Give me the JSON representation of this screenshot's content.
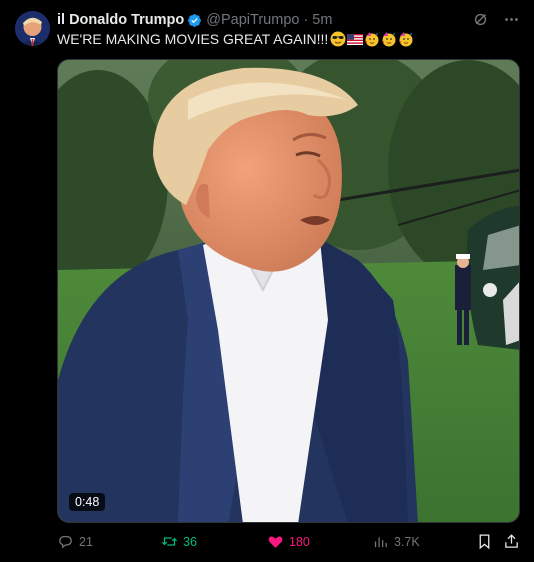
{
  "author": {
    "display_name": "il Donaldo Trumpo",
    "handle": "@PapiTrumpo",
    "separator": "·",
    "time": "5m",
    "verified": true,
    "verified_color": "#1d9bf0"
  },
  "tweet": {
    "text": "WE'RE MAKING MOVIES GREAT AGAIN!!!",
    "emoji_icons": [
      "sunglasses-face-emoji",
      "us-flag-emoji",
      "partying-face-emoji",
      "partying-face-emoji",
      "partying-face-emoji"
    ]
  },
  "media": {
    "type": "video",
    "duration": "0:48"
  },
  "actions": {
    "replies": "21",
    "reposts": "36",
    "likes": "180",
    "views": "3.7K",
    "repost_color": "#00ba7c",
    "like_color": "#f91880"
  },
  "top_icons": [
    "grok-icon",
    "more-icon"
  ]
}
